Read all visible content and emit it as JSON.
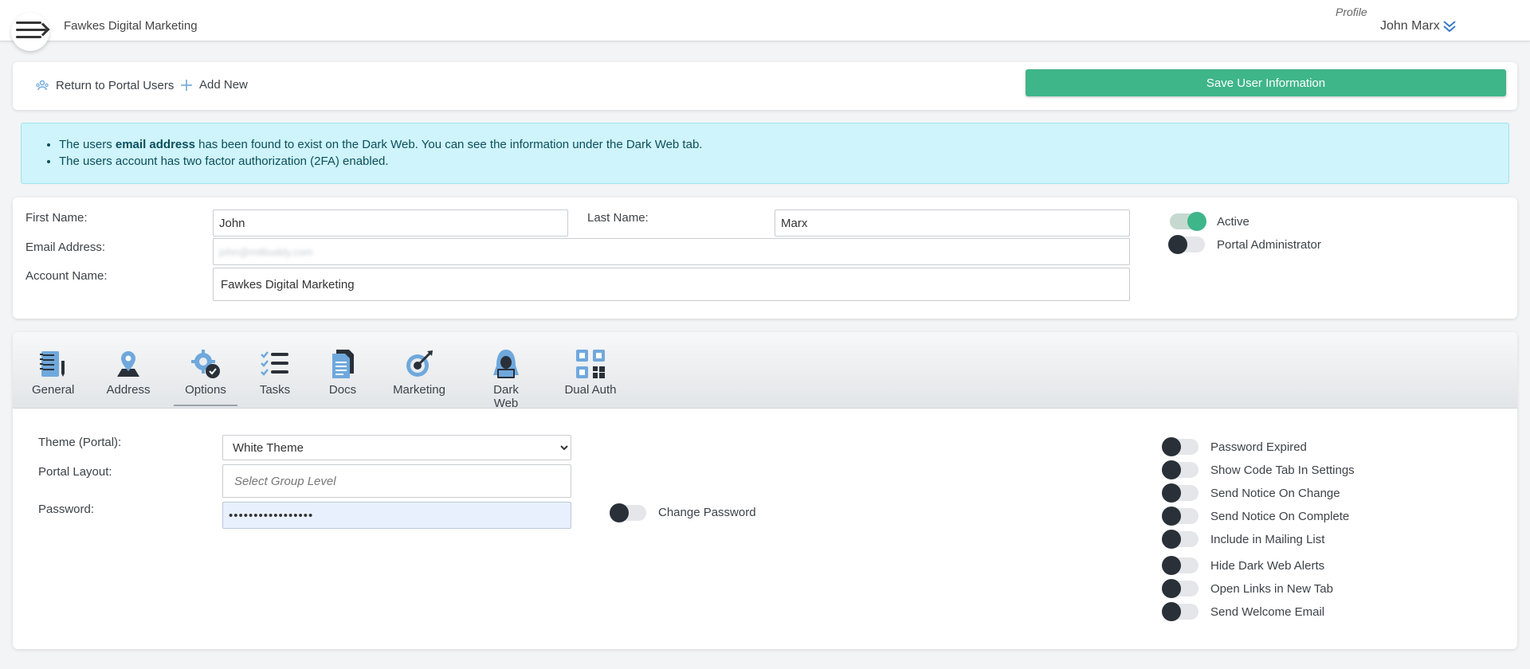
{
  "header": {
    "company": "Fawkes Digital Marketing",
    "profile_alt": "Profile",
    "user_name": "John Marx"
  },
  "toolbar": {
    "return_label": "Return to Portal Users",
    "add_label": "Add New",
    "save_label": "Save User Information"
  },
  "alert": {
    "line1_pre": "The users ",
    "line1_bold": "email address",
    "line1_post": " has been found to exist on the Dark Web. You can see the information under the Dark Web tab.",
    "line2": "The users account has two factor authorization (2FA) enabled."
  },
  "user": {
    "first_name_label": "First Name:",
    "first_name": "John",
    "last_name_label": "Last Name:",
    "last_name": "Marx",
    "email_label": "Email Address:",
    "email": "john@mitbuddy.com",
    "account_label": "Account Name:",
    "account": "Fawkes Digital Marketing",
    "active_label": "Active",
    "active": true,
    "admin_label": "Portal Administrator",
    "admin": false
  },
  "tabs": [
    {
      "label": "General",
      "icon": "notebook-icon"
    },
    {
      "label": "Address",
      "icon": "map-pin-icon"
    },
    {
      "label": "Options",
      "icon": "gear-check-icon"
    },
    {
      "label": "Tasks",
      "icon": "checklist-icon"
    },
    {
      "label": "Docs",
      "icon": "documents-icon"
    },
    {
      "label": "Marketing",
      "icon": "target-icon"
    },
    {
      "label": "Dark Web",
      "icon": "hacker-icon"
    },
    {
      "label": "Dual Auth",
      "icon": "qr-code-icon"
    }
  ],
  "active_tab": "Options",
  "options": {
    "theme_label": "Theme (Portal):",
    "theme_value": "White Theme",
    "layout_label": "Portal Layout:",
    "layout_placeholder": "Select Group Level",
    "password_label": "Password:",
    "password_value": "•••••••••••••••••",
    "change_password_label": "Change Password",
    "toggles": [
      {
        "label": "Password Expired",
        "on": false
      },
      {
        "label": "Show Code Tab In Settings",
        "on": false
      },
      {
        "label": "Send Notice On Change",
        "on": false
      },
      {
        "label": "Send Notice On Complete",
        "on": false
      },
      {
        "label": "Include in Mailing List",
        "on": false
      },
      {
        "label": "Hide Dark Web Alerts",
        "on": false
      },
      {
        "label": "Open Links in New Tab",
        "on": false
      },
      {
        "label": "Send Welcome Email",
        "on": false
      }
    ]
  },
  "colors": {
    "accent_green": "#3fb58a",
    "alert_bg": "#cff4fb",
    "icon_blue": "#6fa8dc",
    "icon_dark": "#2a3038"
  }
}
